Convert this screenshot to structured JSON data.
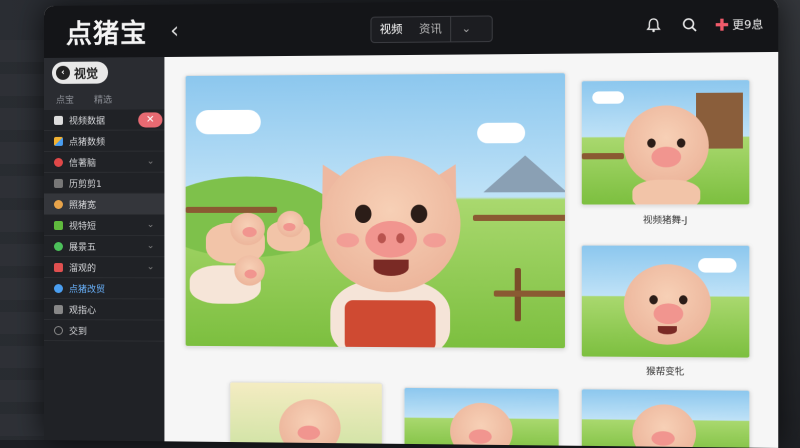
{
  "app": {
    "title": "点猪宝"
  },
  "header": {
    "seg_tabs": [
      "视频",
      "资讯"
    ],
    "user_label": "更9息"
  },
  "sidebar": {
    "title": "视觉",
    "sub_items": [
      "点宝",
      "精选"
    ],
    "items": [
      {
        "label": "视频数据",
        "color": "#dddddd"
      },
      {
        "label": "点猪数频",
        "color": "#f2b233"
      },
      {
        "label": "信著脑",
        "color": "#e04848"
      },
      {
        "label": "历剪剪1",
        "color": "#888888"
      },
      {
        "label": "照猪宽",
        "color": "#e8a44a"
      },
      {
        "label": "视特短",
        "color": "#5fba3d"
      },
      {
        "label": "展景五",
        "color": "#4cc05a"
      },
      {
        "label": "溜观的",
        "color": "#e05050"
      },
      {
        "label": "点猪改贸",
        "color": "#4a9ef0"
      },
      {
        "label": "观指心",
        "color": "#888888"
      },
      {
        "label": "交到",
        "color": "#888888"
      }
    ]
  },
  "gallery": {
    "captions": [
      "视频猪舞-J",
      "猴帮变牝"
    ]
  },
  "colors": {
    "accent": "#e86a72",
    "link": "#6ab4ff",
    "topbar": "#141518",
    "sidebar": "#202226"
  }
}
